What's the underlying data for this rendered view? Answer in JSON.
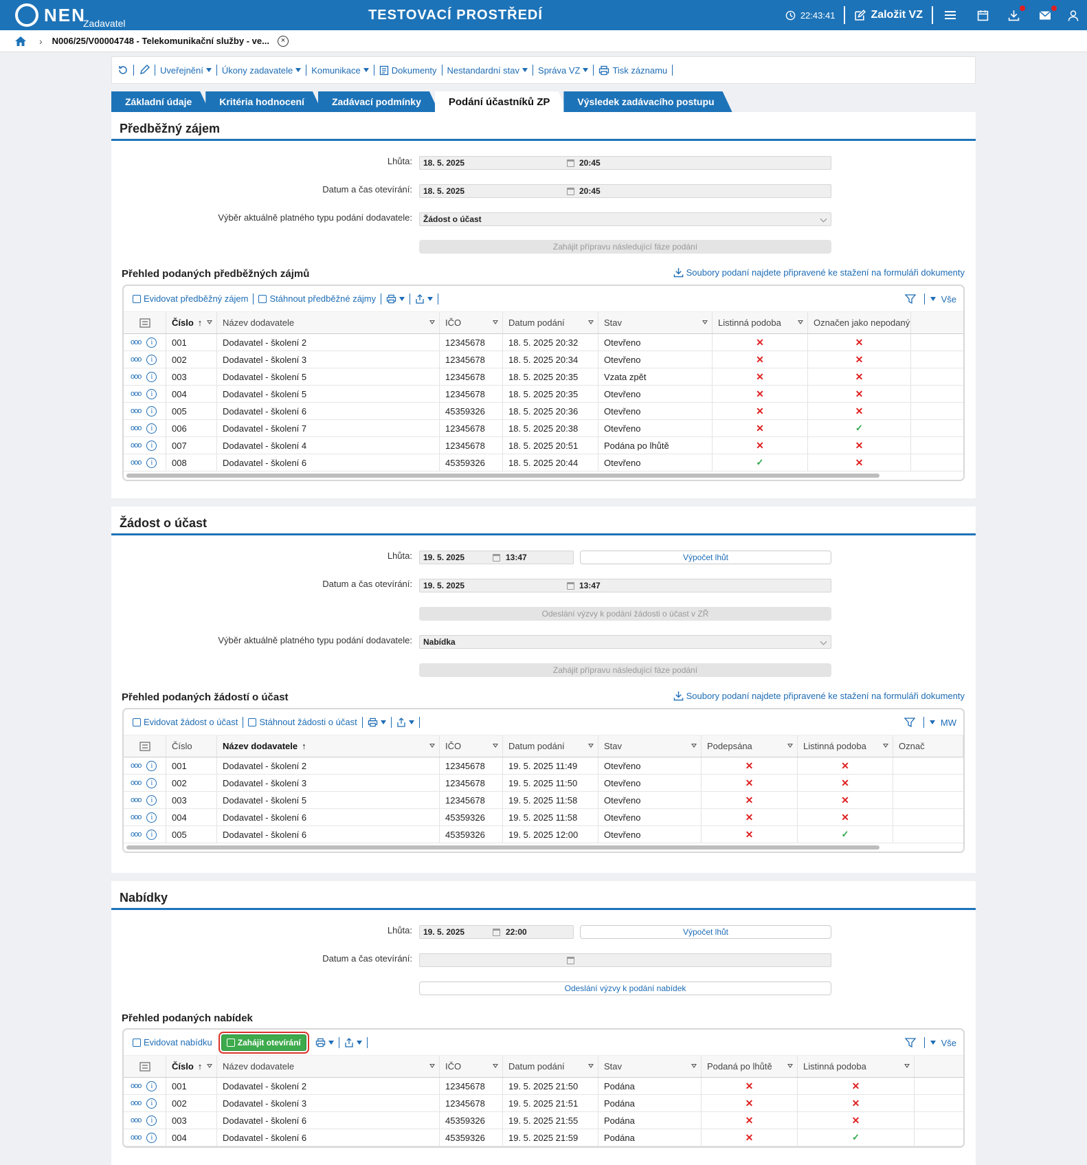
{
  "header": {
    "logo": "NEN",
    "logo_sub": "Zadavatel",
    "env_title": "TESTOVACÍ PROSTŘEDÍ",
    "clock": "22:43:41",
    "create_label": "Založit VZ"
  },
  "breadcrumb": {
    "text": "N006/25/V00004748 - Telekomunikační služby - ve...",
    "close": "×"
  },
  "toolbar": [
    "Uveřejnění",
    "Úkony zadavatele",
    "Komunikace",
    "Dokumenty",
    "Nestandardní stav",
    "Správa VZ",
    "Tisk záznamu"
  ],
  "tabs": [
    "Základní údaje",
    "Kritéria hodnocení",
    "Zadávací podmínky",
    "Podání účastníků ZP",
    "Výsledek zadávacího postupu"
  ],
  "section1": {
    "title": "Předběžný zájem",
    "lhuta_label": "Lhůta:",
    "lhuta_date": "18. 5. 2025",
    "lhuta_time": "20:45",
    "open_label": "Datum a čas otevírání:",
    "open_date": "18. 5. 2025",
    "open_time": "20:45",
    "type_label": "Výběr aktuálně platného typu podání dodavatele:",
    "type_value": "Žádost o účast",
    "next_phase_btn": "Zahájit přípravu následující fáze podání",
    "list_title": "Přehled podaných předběžných zájmů",
    "download_link": "Soubory podaní najdete připravené ke stažení na formuláři dokumenty",
    "grid_btn1": "Evidovat předběžný zájem",
    "grid_btn2": "Stáhnout předběžné zájmy",
    "grid_right": "Vše",
    "columns": [
      "Číslo",
      "Název dodavatele",
      "IČO",
      "Datum podání",
      "Stav",
      "Listinná podoba",
      "Označen jako nepodaný"
    ],
    "rows": [
      [
        "001",
        "Dodavatel - školení 2",
        "12345678",
        "18. 5. 2025 20:32",
        "Otevřeno",
        "x",
        "x"
      ],
      [
        "002",
        "Dodavatel - školení 3",
        "12345678",
        "18. 5. 2025 20:34",
        "Otevřeno",
        "x",
        "x"
      ],
      [
        "003",
        "Dodavatel - školení 5",
        "12345678",
        "18. 5. 2025 20:35",
        "Vzata zpět",
        "x",
        "x"
      ],
      [
        "004",
        "Dodavatel - školení 5",
        "12345678",
        "18. 5. 2025 20:35",
        "Otevřeno",
        "x",
        "x"
      ],
      [
        "005",
        "Dodavatel - školení 6",
        "45359326",
        "18. 5. 2025 20:36",
        "Otevřeno",
        "x",
        "x"
      ],
      [
        "006",
        "Dodavatel - školení 7",
        "12345678",
        "18. 5. 2025 20:38",
        "Otevřeno",
        "x",
        "ok"
      ],
      [
        "007",
        "Dodavatel - školení 4",
        "12345678",
        "18. 5. 2025 20:51",
        "Podána po lhůtě",
        "x",
        "x"
      ],
      [
        "008",
        "Dodavatel - školení 6",
        "45359326",
        "18. 5. 2025 20:44",
        "Otevřeno",
        "ok",
        "x"
      ]
    ]
  },
  "section2": {
    "title": "Žádost o účast",
    "lhuta_label": "Lhůta:",
    "lhuta_date": "19. 5. 2025",
    "lhuta_time": "13:47",
    "calc_btn": "Výpočet lhůt",
    "open_label": "Datum a čas otevírání:",
    "open_date": "19. 5. 2025",
    "open_time": "13:47",
    "send_btn": "Odeslání výzvy k podání žádosti o účast v ZŘ",
    "type_label": "Výběr aktuálně platného typu podání dodavatele:",
    "type_value": "Nabídka",
    "next_phase_btn": "Zahájit přípravu následující fáze podání",
    "list_title": "Přehled podaných žádostí o účast",
    "download_link": "Soubory podaní najdete připravené ke stažení na formuláři dokumenty",
    "grid_btn1": "Evidovat žádost o účast",
    "grid_btn2": "Stáhnout žádosti o účast",
    "grid_right": "MW",
    "columns": [
      "Číslo",
      "Název dodavatele",
      "IČO",
      "Datum podání",
      "Stav",
      "Podepsána",
      "Listinná podoba",
      "Označ"
    ],
    "rows": [
      [
        "001",
        "Dodavatel - školení 2",
        "12345678",
        "19. 5. 2025 11:49",
        "Otevřeno",
        "x",
        "x"
      ],
      [
        "002",
        "Dodavatel - školení 3",
        "12345678",
        "19. 5. 2025 11:50",
        "Otevřeno",
        "x",
        "x"
      ],
      [
        "003",
        "Dodavatel - školení 5",
        "12345678",
        "19. 5. 2025 11:58",
        "Otevřeno",
        "x",
        "x"
      ],
      [
        "004",
        "Dodavatel - školení 6",
        "45359326",
        "19. 5. 2025 11:58",
        "Otevřeno",
        "x",
        "x"
      ],
      [
        "005",
        "Dodavatel - školení 6",
        "45359326",
        "19. 5. 2025 12:00",
        "Otevřeno",
        "x",
        "ok"
      ]
    ]
  },
  "section3": {
    "title": "Nabídky",
    "lhuta_label": "Lhůta:",
    "lhuta_date": "19. 5. 2025",
    "lhuta_time": "22:00",
    "calc_btn": "Výpočet lhůt",
    "open_label": "Datum a čas otevírání:",
    "send_btn": "Odeslání výzvy k podání nabídek",
    "list_title": "Přehled podaných nabídek",
    "grid_btn1": "Evidovat nabídku",
    "grid_btn_green": "Zahájit otevírání",
    "grid_right": "Vše",
    "columns": [
      "Číslo",
      "Název dodavatele",
      "IČO",
      "Datum podání",
      "Stav",
      "Podaná po lhůtě",
      "Listinná podoba"
    ],
    "rows": [
      [
        "001",
        "Dodavatel - školení 2",
        "12345678",
        "19. 5. 2025 21:50",
        "Podána",
        "x",
        "x"
      ],
      [
        "002",
        "Dodavatel - školení 3",
        "12345678",
        "19. 5. 2025 21:51",
        "Podána",
        "x",
        "x"
      ],
      [
        "003",
        "Dodavatel - školení 6",
        "45359326",
        "19. 5. 2025 21:55",
        "Podána",
        "x",
        "x"
      ],
      [
        "004",
        "Dodavatel - školení 6",
        "45359326",
        "19. 5. 2025 21:59",
        "Podána",
        "x",
        "ok"
      ]
    ]
  },
  "icons": {
    "cross": "✕",
    "check": "✓",
    "dots": "ooo",
    "info": "i",
    "sort_up": "↑"
  },
  "colors": {
    "brand": "#1d73b8",
    "link": "#1d6cb5",
    "error": "#e02020",
    "success": "#2da84a",
    "green_button": "#3daa4c"
  }
}
